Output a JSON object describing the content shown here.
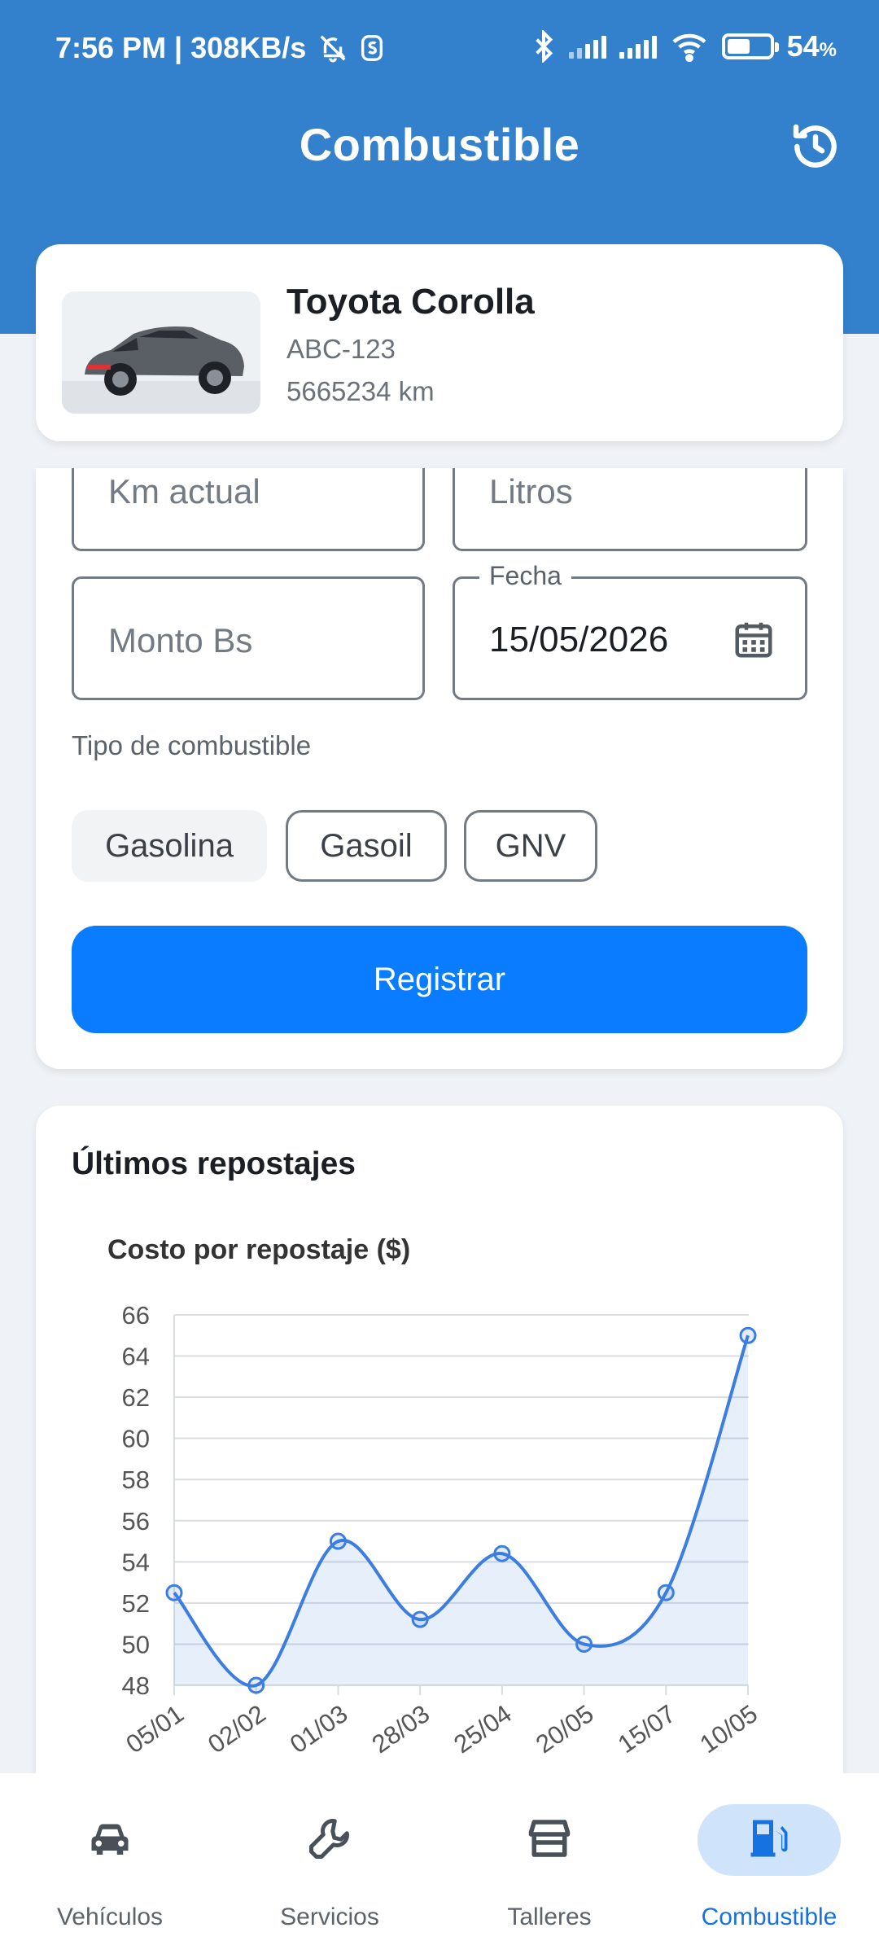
{
  "status_bar": {
    "time_speed": "7:56 PM | 308KB/s",
    "battery_percent": "54",
    "battery_suffix": "%",
    "battery_level": 0.54,
    "icons": [
      "mute-bell-icon",
      "s-icon",
      "bluetooth-icon",
      "signal-icon",
      "signal-icon",
      "wifi-icon",
      "battery-icon"
    ]
  },
  "header": {
    "title": "Combustible",
    "history_icon": "history-icon"
  },
  "vehicle": {
    "name": "Toyota Corolla",
    "plate": "ABC-123",
    "km": "5665234 km"
  },
  "form": {
    "km_placeholder": "Km actual",
    "litros_placeholder": "Litros",
    "monto_placeholder": "Monto Bs",
    "fecha_label": "Fecha",
    "fecha_value": "15/05/2026",
    "fuel_type_label": "Tipo de combustible",
    "fuel_types": [
      "Gasolina",
      "Gasoil",
      "GNV"
    ],
    "selected_fuel": "Gasolina",
    "register_label": "Registrar"
  },
  "history": {
    "title": "Últimos repostajes"
  },
  "chart_data": {
    "type": "area",
    "title": "Costo por repostaje ($)",
    "categories": [
      "05/01",
      "02/02",
      "01/03",
      "28/03",
      "25/04",
      "20/05",
      "15/07",
      "10/05"
    ],
    "series": [
      {
        "values": [
          52.5,
          48.0,
          55.0,
          51.2,
          54.4,
          50.0,
          52.5,
          65.0
        ]
      }
    ],
    "ylim": [
      48,
      66
    ],
    "yticks": [
      48,
      50,
      52,
      54,
      56,
      58,
      60,
      62,
      64,
      66
    ],
    "grid": true,
    "color": "#3b7de0"
  },
  "bottom_nav": {
    "items": [
      {
        "label": "Vehículos",
        "icon": "car-icon"
      },
      {
        "label": "Servicios",
        "icon": "wrench-icon"
      },
      {
        "label": "Talleres",
        "icon": "store-icon"
      },
      {
        "label": "Combustible",
        "icon": "fuel-pump-icon"
      }
    ],
    "active": "Combustible"
  },
  "colors": {
    "header": "#3380cc",
    "primary_button": "#0a7cff",
    "active_nav": "#1672e0"
  }
}
